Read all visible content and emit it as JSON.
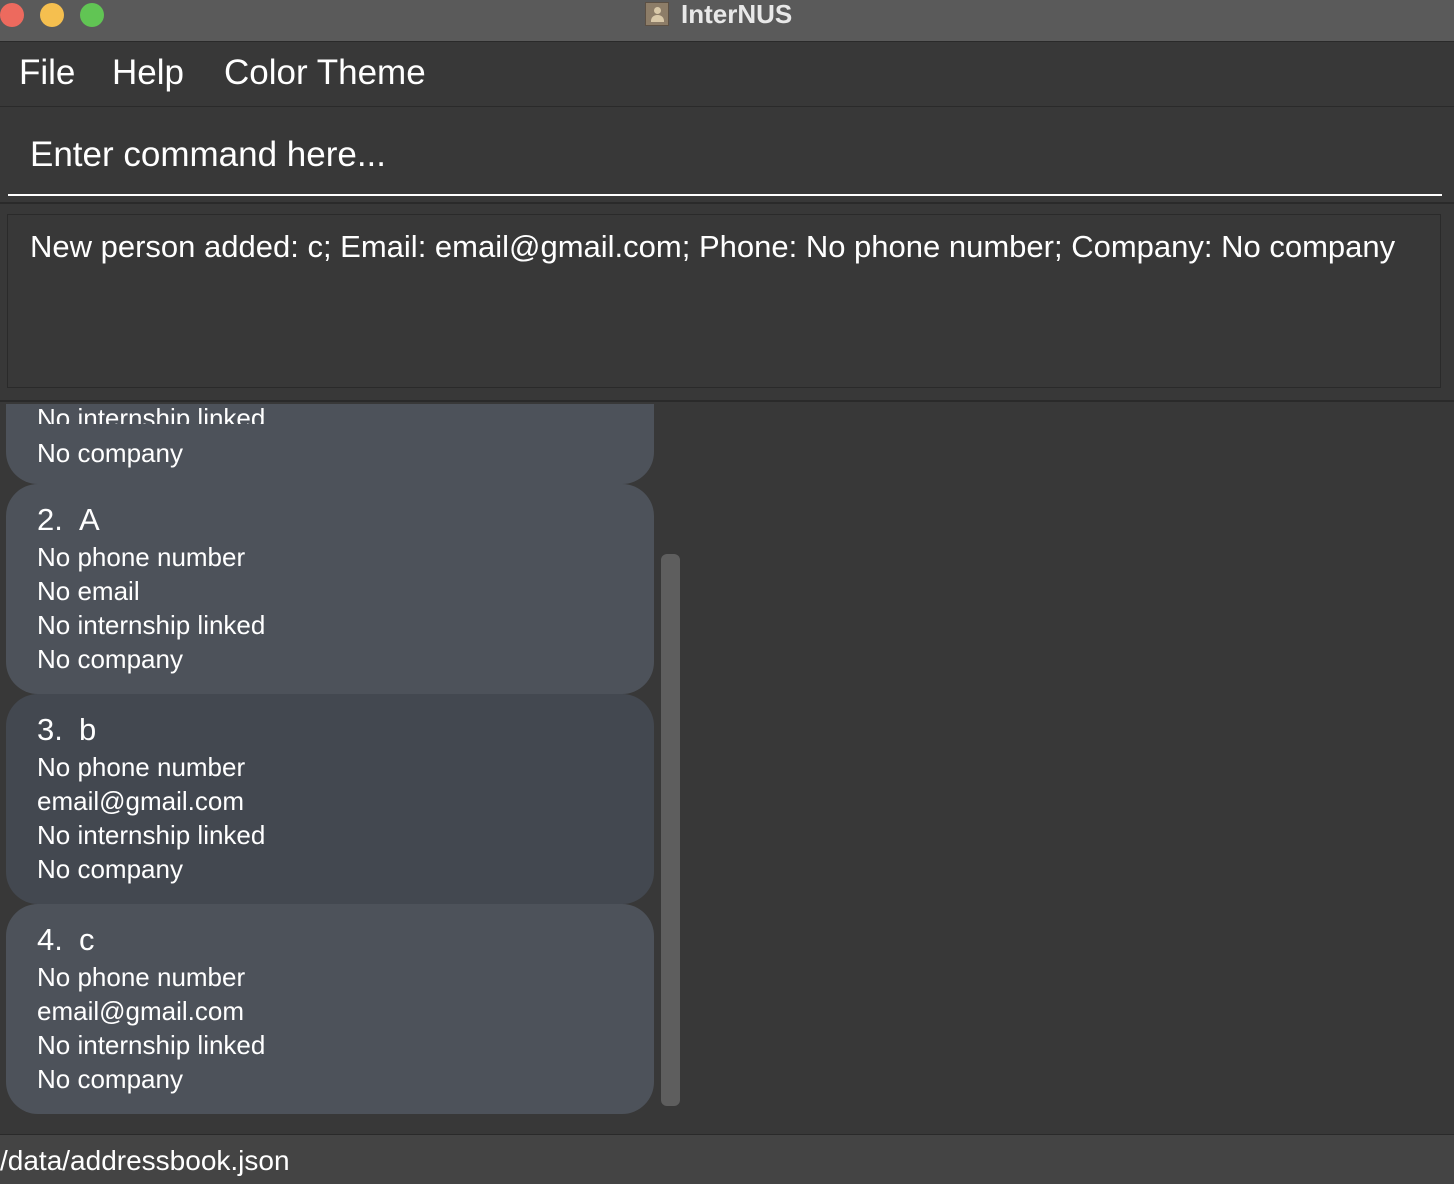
{
  "window": {
    "title": "InterNUS"
  },
  "menu": {
    "items": [
      "File",
      "Help",
      "Color Theme"
    ]
  },
  "command": {
    "placeholder": "Enter command here...",
    "value": ""
  },
  "result": {
    "message": "New person added: c; Email: email@gmail.com; Phone: No phone number; Company: No company"
  },
  "persons": [
    {
      "partial_line": "No internship linked",
      "company": "No company"
    },
    {
      "index": "2.",
      "name": "A",
      "phone": "No phone number",
      "email": "No email",
      "internship": "No internship linked",
      "company": "No company"
    },
    {
      "index": "3.",
      "name": "b",
      "phone": "No phone number",
      "email": "email@gmail.com",
      "internship": "No internship linked",
      "company": "No company"
    },
    {
      "index": "4.",
      "name": "c",
      "phone": "No phone number",
      "email": "email@gmail.com",
      "internship": "No internship linked",
      "company": "No company"
    }
  ],
  "status": {
    "file_path": "/data/addressbook.json"
  }
}
